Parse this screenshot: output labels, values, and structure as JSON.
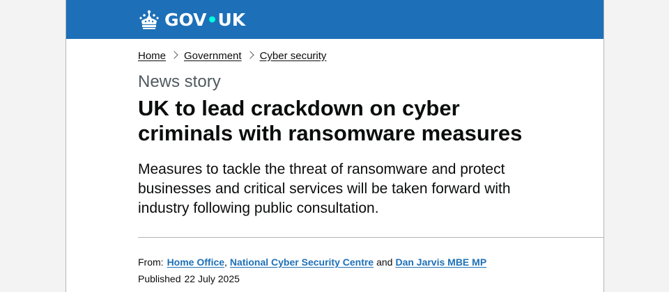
{
  "header": {
    "logo_text_left": "GOV",
    "logo_dot": "•",
    "logo_text_right": "UK",
    "brand_color": "#1d70b8",
    "dot_color": "#00ffe0"
  },
  "breadcrumbs": [
    {
      "label": "Home"
    },
    {
      "label": "Government"
    },
    {
      "label": "Cyber security"
    }
  ],
  "article": {
    "caption": "News story",
    "title": "UK to lead crackdown on cyber criminals with ransomware measures",
    "lead": "Measures to tackle the threat of ransomware and protect businesses and critical services will be taken forward with industry following public consultation."
  },
  "metadata": {
    "from_label": "From:",
    "organisations": [
      {
        "label": "Home Office"
      },
      {
        "label": "National Cyber Security Centre"
      },
      {
        "label": "Dan Jarvis MBE MP"
      }
    ],
    "comma": ",",
    "and_word": "and",
    "published_label": "Published",
    "published_date": "22 July 2025"
  },
  "colors": {
    "text": "#0b0c0c",
    "secondary_text": "#505a5f",
    "link": "#1d70b8",
    "border": "#b1b4b6"
  }
}
